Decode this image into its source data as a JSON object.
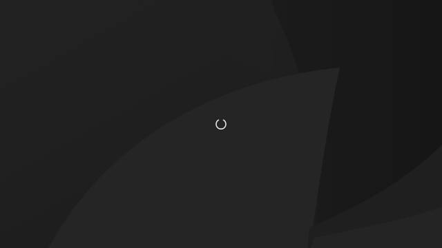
{
  "screen": {
    "state": "loading",
    "background_color": "#202020",
    "spinner_color": "#e6e6e6",
    "spinner_icon": "loading-spinner-icon"
  }
}
